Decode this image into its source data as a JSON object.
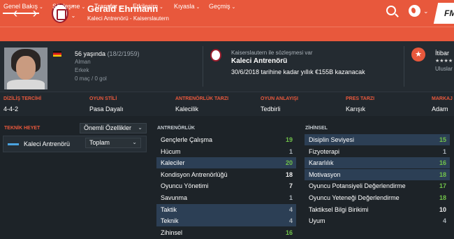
{
  "header": {
    "title": "Gerald Ehrmann",
    "subtitle": "Kaleci Antrenörü - Kaiserslautern",
    "back_glyph": "‹",
    "forward_glyph": "›",
    "stepper_up": "⌃",
    "stepper_down": "⌄",
    "logo_text": "FM",
    "accent_color": "#e8583c"
  },
  "tabs": [
    {
      "label": "Genel Bakış",
      "has_menu": true,
      "active": true
    },
    {
      "label": "Sözleşme",
      "has_menu": true
    },
    {
      "label": "Transfer",
      "has_menu": true
    },
    {
      "label": "Etkileşim",
      "has_menu": true
    },
    {
      "label": "Kıyasla",
      "has_menu": true
    },
    {
      "label": "Geçmiş",
      "has_menu": true
    }
  ],
  "profile": {
    "age_text": "56 yaşında",
    "birth_date": "(18/2/1959)",
    "nationality": "Alman",
    "gender": "Erkek",
    "record": "0 maç / 0 gol"
  },
  "contract": {
    "small": "Kaiserslautern ile sözleşmesi var",
    "role": "Kaleci Antrenörü",
    "details": "30/6/2018 tarihine kadar yıllık €155B kazanacak"
  },
  "reputation": {
    "title": "İtibar",
    "stars": "★★★★",
    "scope": "Uluslar"
  },
  "tactics": [
    {
      "label": "DİZİLİŞ TERCİHİ",
      "value": "4-4-2"
    },
    {
      "label": "OYUN STİLİ",
      "value": "Pasa Dayalı"
    },
    {
      "label": "ANTRENÖRLÜK TARZI",
      "value": "Kalecilik"
    },
    {
      "label": "OYUN ANLAYIŞI",
      "value": "Tedbirli"
    },
    {
      "label": "PRES TARZI",
      "value": "Karışık"
    },
    {
      "label": "MARKAJ",
      "value": "Adam"
    }
  ],
  "left_panel": {
    "heading": "TEKNİK HEYET",
    "filter_select": "Önemli Özellikler",
    "staff_name": "Kaleci Antrenörü",
    "view_select": "Toplam",
    "select_arrow": "⌄"
  },
  "coaching": {
    "heading": "ANTRENÖRLÜK",
    "rows": [
      {
        "name": "Gençlerle Çalışma",
        "value": "19",
        "color": "green",
        "highlight": false
      },
      {
        "name": "Hücum",
        "value": "1",
        "color": "grey",
        "highlight": false
      },
      {
        "name": "Kaleciler",
        "value": "20",
        "color": "green",
        "highlight": true
      },
      {
        "name": "Kondisyon Antrenörlüğü",
        "value": "18",
        "color": "white",
        "highlight": false
      },
      {
        "name": "Oyuncu Yönetimi",
        "value": "7",
        "color": "white",
        "highlight": false
      },
      {
        "name": "Savunma",
        "value": "1",
        "color": "grey",
        "highlight": false
      },
      {
        "name": "Taktik",
        "value": "4",
        "color": "grey",
        "highlight": true
      },
      {
        "name": "Teknik",
        "value": "4",
        "color": "grey",
        "highlight": true
      },
      {
        "name": "Zihinsel",
        "value": "16",
        "color": "green",
        "highlight": false
      }
    ]
  },
  "mental": {
    "heading": "ZİHİNSEL",
    "rows": [
      {
        "name": "Disiplin Seviyesi",
        "value": "15",
        "color": "green",
        "highlight": true
      },
      {
        "name": "Fizyoterapi",
        "value": "1",
        "color": "grey",
        "highlight": false
      },
      {
        "name": "Kararlılık",
        "value": "16",
        "color": "green",
        "highlight": true
      },
      {
        "name": "Motivasyon",
        "value": "18",
        "color": "green",
        "highlight": true
      },
      {
        "name": "Oyuncu Potansiyeli Değerlendirme",
        "value": "17",
        "color": "green",
        "highlight": false
      },
      {
        "name": "Oyuncu Yeteneği Değerlendirme",
        "value": "18",
        "color": "green",
        "highlight": false
      },
      {
        "name": "Taktiksel Bilgi Birikimi",
        "value": "10",
        "color": "white",
        "highlight": false
      },
      {
        "name": "Uyum",
        "value": "4",
        "color": "grey",
        "highlight": false
      }
    ]
  }
}
